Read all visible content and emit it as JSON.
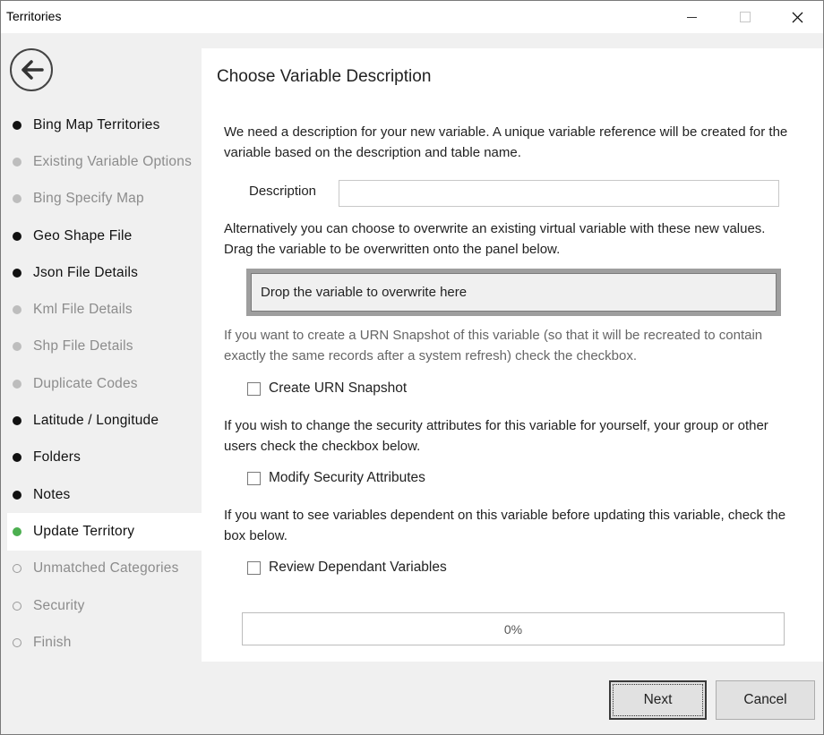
{
  "window": {
    "title": "Territories"
  },
  "sidebar": {
    "items": [
      {
        "label": "Bing Map Territories",
        "state": "done"
      },
      {
        "label": "Existing Variable Options",
        "state": "skipped"
      },
      {
        "label": "Bing Specify Map",
        "state": "skipped"
      },
      {
        "label": "Geo Shape File",
        "state": "done"
      },
      {
        "label": "Json File Details",
        "state": "done"
      },
      {
        "label": "Kml File Details",
        "state": "skipped"
      },
      {
        "label": "Shp File Details",
        "state": "skipped"
      },
      {
        "label": "Duplicate Codes",
        "state": "skipped"
      },
      {
        "label": "Latitude / Longitude",
        "state": "done"
      },
      {
        "label": "Folders",
        "state": "done"
      },
      {
        "label": "Notes",
        "state": "done"
      },
      {
        "label": "Update Territory",
        "state": "current"
      },
      {
        "label": "Unmatched Categories",
        "state": "todo"
      },
      {
        "label": "Security",
        "state": "todo"
      },
      {
        "label": "Finish",
        "state": "todo"
      }
    ]
  },
  "main": {
    "title": "Choose Variable Description",
    "intro": "We need a description for your new variable.  A unique variable reference will be created for the variable based on the description and table name.",
    "description_label": "Description",
    "description_value": "",
    "overwrite_text": "Alternatively you can choose to overwrite an existing virtual variable with these new values. Drag the variable to be overwritten onto the panel below.",
    "drop_zone_text": "Drop the variable to overwrite here",
    "urn_text": "If you want to create a URN Snapshot of this variable (so that it will be recreated to contain exactly the same records after a system refresh) check the checkbox.",
    "urn_checkbox_label": "Create URN Snapshot",
    "security_text": "If you wish to change the security attributes for this variable for yourself, your group or other users check the checkbox below.",
    "security_checkbox_label": "Modify Security Attributes",
    "dependent_text": "If you want to see variables dependent on this variable before updating this variable, check the box below.",
    "dependent_checkbox_label": "Review Dependant Variables",
    "progress_text": "0%",
    "progress_value": 0
  },
  "footer": {
    "next_label": "Next",
    "cancel_label": "Cancel"
  },
  "colors": {
    "current_step": "#4caf50",
    "done_step": "#111111",
    "skipped_step": "#bdbdbd"
  }
}
